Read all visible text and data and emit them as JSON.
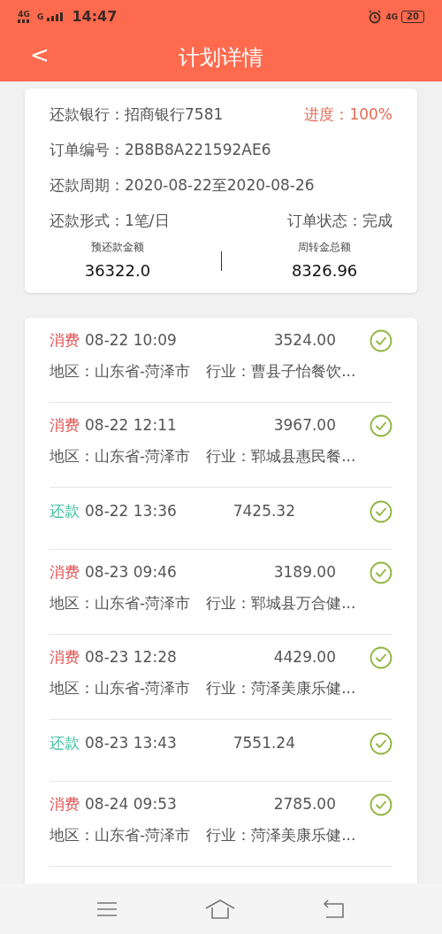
{
  "status_bar": {
    "network_1": "4G",
    "network_2": "G",
    "time": "14:47",
    "network_3": "4G",
    "battery": "20"
  },
  "header": {
    "back": "<",
    "title": "计划详情"
  },
  "summary": {
    "bank": "还款银行：招商银行7581",
    "progress": "进度：100%",
    "order_no": "订单编号：2B8B8A221592AE6",
    "period": "还款周期：2020-08-22至2020-08-26",
    "mode": "还款形式：1笔/日",
    "order_status": "订单状态：完成",
    "totals": [
      {
        "label": "预还款金额",
        "value": "36322.0"
      },
      {
        "label": "周转金总额",
        "value": "8326.96"
      }
    ]
  },
  "transactions": [
    {
      "kind": "consume",
      "type": "消费",
      "time": "08-22 10:09",
      "amount": "3524.00",
      "region": "地区：山东省-菏泽市",
      "industry": "行业：曹县子怡餐饮..."
    },
    {
      "kind": "consume",
      "type": "消费",
      "time": "08-22 12:11",
      "amount": "3967.00",
      "region": "地区：山东省-菏泽市",
      "industry": "行业：郓城县惠民餐..."
    },
    {
      "kind": "repay",
      "type": "还款",
      "time": "08-22 13:36",
      "amount": "7425.32"
    },
    {
      "kind": "consume",
      "type": "消费",
      "time": "08-23 09:46",
      "amount": "3189.00",
      "region": "地区：山东省-菏泽市",
      "industry": "行业：郓城县万合健..."
    },
    {
      "kind": "consume",
      "type": "消费",
      "time": "08-23 12:28",
      "amount": "4429.00",
      "region": "地区：山东省-菏泽市",
      "industry": "行业：菏泽美康乐健..."
    },
    {
      "kind": "repay",
      "type": "还款",
      "time": "08-23 13:43",
      "amount": "7551.24"
    },
    {
      "kind": "consume",
      "type": "消费",
      "time": "08-24 09:53",
      "amount": "2785.00",
      "region": "地区：山东省-菏泽市",
      "industry": "行业：菏泽美康乐健..."
    }
  ]
}
